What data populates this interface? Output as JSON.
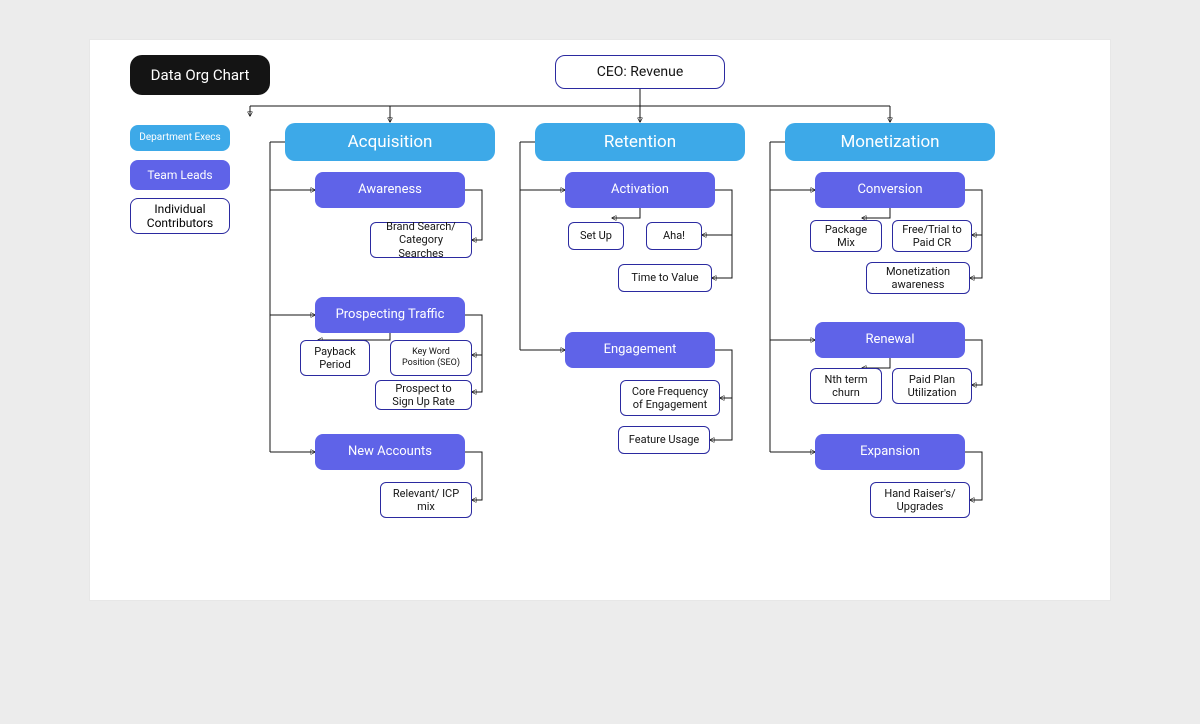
{
  "title": "Data Org Chart",
  "root": "CEO: Revenue",
  "legend": {
    "dept": "Department Execs",
    "lead": "Team Leads",
    "ic": "Individual Contributors"
  },
  "departments": {
    "acquisition": {
      "label": "Acquisition",
      "teams": {
        "awareness": {
          "label": "Awareness",
          "ics": {
            "brand_search": "Brand Search/ Category Searches"
          }
        },
        "prospecting": {
          "label": "Prospecting Traffic",
          "ics": {
            "payback": "Payback Period",
            "seo": "Key Word Position (SEO)",
            "signup_rate": "Prospect to Sign Up Rate"
          }
        },
        "new_accounts": {
          "label": "New Accounts",
          "ics": {
            "icp_mix": "Relevant/ ICP mix"
          }
        }
      }
    },
    "retention": {
      "label": "Retention",
      "teams": {
        "activation": {
          "label": "Activation",
          "ics": {
            "setup": "Set Up",
            "aha": "Aha!",
            "ttv": "Time to Value"
          }
        },
        "engagement": {
          "label": "Engagement",
          "ics": {
            "core_freq": "Core Frequency of Engagement",
            "feature_usage": "Feature Usage"
          }
        }
      }
    },
    "monetization": {
      "label": "Monetization",
      "teams": {
        "conversion": {
          "label": "Conversion",
          "ics": {
            "package_mix": "Package Mix",
            "trial_paid": "Free/Trial to Paid CR",
            "mon_aware": "Monetization awareness"
          }
        },
        "renewal": {
          "label": "Renewal",
          "ics": {
            "nth_churn": "Nth term churn",
            "plan_util": "Paid Plan Utilization"
          }
        },
        "expansion": {
          "label": "Expansion",
          "ics": {
            "upgrades": "Hand Raiser's/ Upgrades"
          }
        }
      }
    }
  }
}
